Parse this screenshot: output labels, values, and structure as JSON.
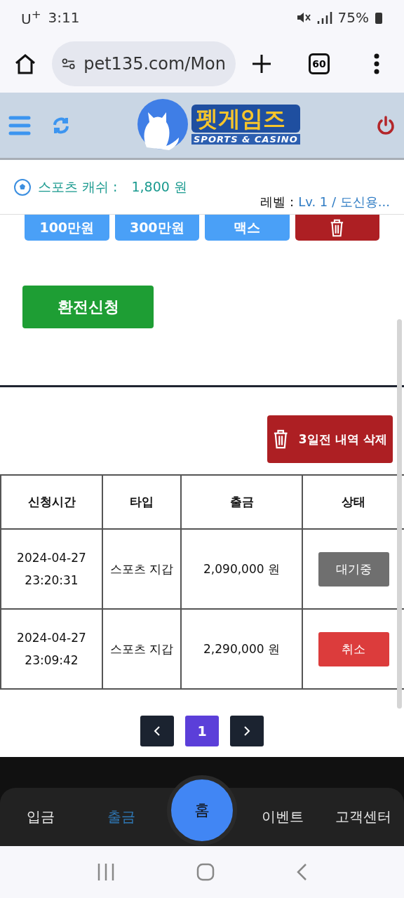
{
  "status_bar": {
    "carrier": "U$^{+}$",
    "time": "3:11",
    "battery": "75%"
  },
  "browser": {
    "url": "pet135.com/Mon",
    "tab_count": "60"
  },
  "header": {
    "logo_title": "펫게임즈",
    "logo_subtitle": "SPORTS & CASINO"
  },
  "info": {
    "cash_label": "스포츠 캐쉬 :",
    "cash_value": "1,800 원",
    "level_label": "레벨 :",
    "level_value": "Lv. 1 / 도신용..."
  },
  "amount_buttons": [
    {
      "kind": "amount",
      "label": "100만원"
    },
    {
      "kind": "amount",
      "label": "300만원"
    },
    {
      "kind": "amount",
      "label": "맥스"
    },
    {
      "kind": "trash"
    }
  ],
  "exchange_button": "환전신청",
  "delete_button": "3일전 내역 삭제",
  "table": {
    "columns": [
      "신청시간",
      "타입",
      "출금",
      "상태"
    ],
    "rows": [
      {
        "date": "2024-04-27",
        "time": "23:20:31",
        "type": "스포츠 지갑",
        "amount": "2,090,000 원",
        "status": {
          "kind": "pending",
          "label": "대기중"
        }
      },
      {
        "date": "2024-04-27",
        "time": "23:09:42",
        "type": "스포츠 지갑",
        "amount": "2,290,000 원",
        "status": {
          "kind": "cancelled",
          "label": "취소"
        }
      }
    ]
  },
  "pagination": {
    "pages": [
      {
        "label": "1",
        "selected": true
      }
    ]
  },
  "bottom_nav": {
    "items": [
      {
        "label": "입금",
        "selected": false
      },
      {
        "label": "출금",
        "selected": true
      },
      {
        "label": "이벤트",
        "selected": false
      },
      {
        "label": "고객센터",
        "selected": false
      }
    ],
    "home": "홈"
  }
}
